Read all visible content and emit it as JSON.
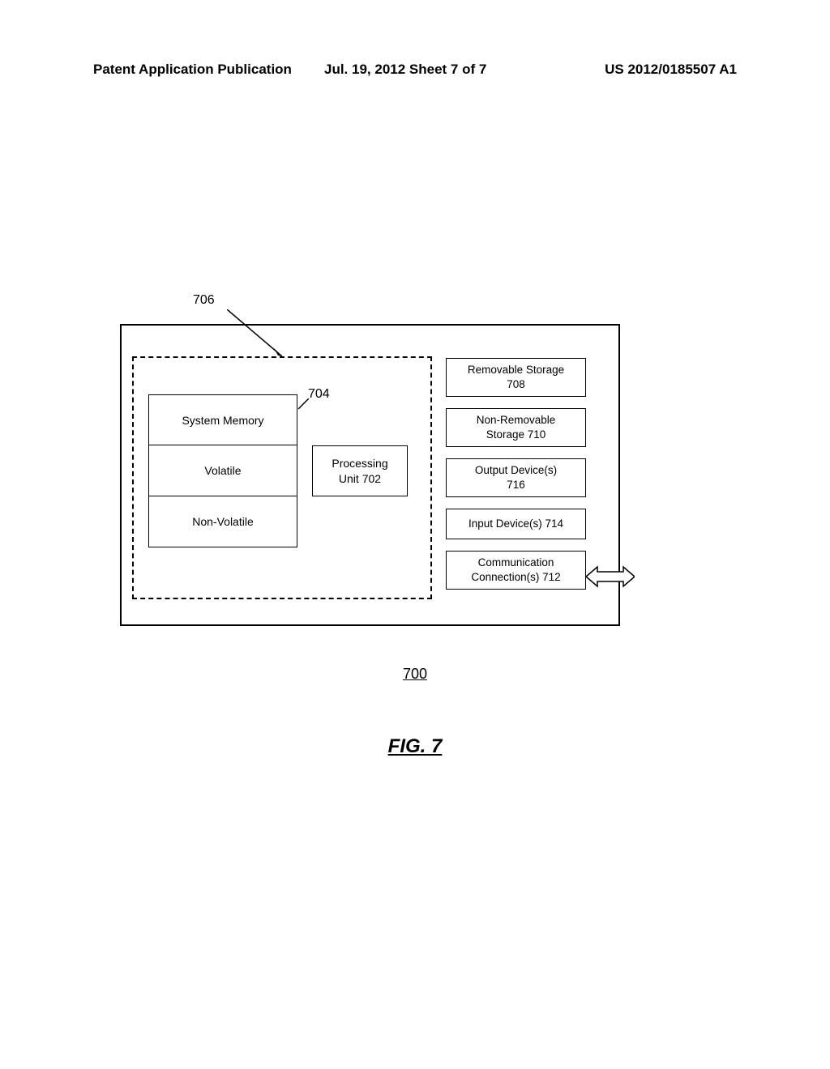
{
  "header": {
    "left": "Patent Application Publication",
    "mid": "Jul. 19, 2012  Sheet 7 of 7",
    "right": "US 2012/0185507 A1"
  },
  "labels": {
    "ref706": "706",
    "ref704": "704",
    "ref700": "700",
    "figure": "FIG. 7"
  },
  "sysmem": {
    "row0": "System Memory",
    "row1": "Volatile",
    "row2": "Non-Volatile"
  },
  "proc": "Processing\nUnit 702",
  "right": {
    "b0": "Removable Storage\n708",
    "b1": "Non-Removable\nStorage 710",
    "b2": "Output Device(s)\n716",
    "b3": "Input Device(s) 714",
    "b4": "Communication\nConnection(s) 712"
  }
}
